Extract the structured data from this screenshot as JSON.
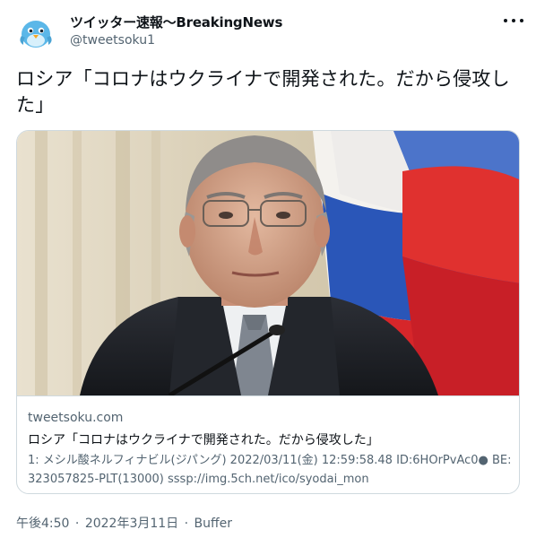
{
  "author": {
    "name": "ツイッター速報〜BreakingNews",
    "handle": "@tweetsoku1",
    "avatar_icon": "bird-avatar-icon",
    "avatar_color": "#5bb7e8"
  },
  "menu": {
    "more_icon": "more-options-icon"
  },
  "tweet": {
    "text": "ロシア「コロナはウクライナで開発された。だから侵攻した」"
  },
  "card": {
    "image_description_icon": "news-photo",
    "domain": "tweetsoku.com",
    "title": "ロシア「コロナはウクライナで開発された。だから侵攻した」",
    "description": "1: メシル酸ネルフィナビル(ジパング) 2022/03/11(金) 12:59:58.48 ID:6HOrPvAc0● BE:323057825-PLT(13000) sssp://img.5ch.net/ico/syodai_mon"
  },
  "meta": {
    "time": "午後4:50",
    "separator": "·",
    "date": "2022年3月11日",
    "source": "Buffer"
  },
  "colors": {
    "text": "#0f1419",
    "secondary": "#536471",
    "border": "#cfd9de"
  }
}
